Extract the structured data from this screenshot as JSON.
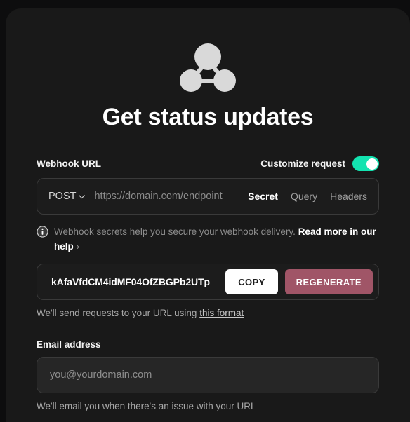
{
  "card": {
    "logo_icon": "webhook-triad-icon",
    "title": "Get status updates"
  },
  "webhook": {
    "url_label": "Webhook URL",
    "customize": {
      "label": "Customize request",
      "toggle_state": "on",
      "toggle_color": "#13e3b0"
    },
    "url_bar": {
      "method": "POST",
      "method_chevron_icon": "chevron-down-icon",
      "url_value": "",
      "url_placeholder": "https://domain.com/endpoint",
      "tabs": [
        {
          "label": "Secret",
          "active": true
        },
        {
          "label": "Query",
          "active": false
        },
        {
          "label": "Headers",
          "active": false
        }
      ]
    },
    "note": {
      "icon": "info-icon",
      "text": "Webhook secrets help you secure your webhook delivery. ",
      "link_text": "Read more in our help",
      "link_chevron": "›"
    },
    "secret": {
      "value": "kAfaVfdCM4idMF04OfZBGPb2UTp",
      "copy_label": "COPY",
      "regenerate_label": "REGENERATE",
      "regenerate_color": "#a05567"
    },
    "format_helper": {
      "text": "We'll send requests to your URL using ",
      "link_text": "this format"
    }
  },
  "email": {
    "label": "Email address",
    "value": "",
    "placeholder": "you@yourdomain.com",
    "helper": "We'll email you when there's an issue with your URL"
  }
}
